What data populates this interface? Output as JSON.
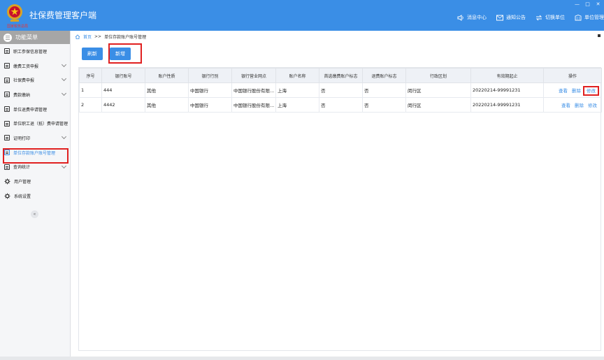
{
  "app": {
    "title": "社保费管理客户端",
    "logo_sub": "国家税务总局"
  },
  "window_controls": [
    "—",
    "□",
    "✕"
  ],
  "header_nav": [
    {
      "label": "消息中心",
      "icon": "message-icon"
    },
    {
      "label": "通知公告",
      "icon": "notice-icon"
    },
    {
      "label": "切换单位",
      "icon": "switch-icon"
    },
    {
      "label": "单位管理",
      "icon": "building-icon"
    }
  ],
  "sidebar": {
    "title": "功能菜单",
    "items": [
      {
        "label": "职工参保信息管理",
        "icon": "doc-icon",
        "chevron": false,
        "active": false
      },
      {
        "label": "缴费工资申报",
        "icon": "doc-icon",
        "chevron": true,
        "active": false
      },
      {
        "label": "社保费申报",
        "icon": "doc-icon",
        "chevron": true,
        "active": false
      },
      {
        "label": "费款缴纳",
        "icon": "doc-icon",
        "chevron": true,
        "active": false
      },
      {
        "label": "单位退费申请管理",
        "icon": "doc-icon",
        "chevron": false,
        "active": false
      },
      {
        "label": "单位职工退（抵）费申请管理",
        "icon": "doc-icon",
        "chevron": false,
        "active": false
      },
      {
        "label": "证明打印",
        "icon": "doc-icon",
        "chevron": true,
        "active": false
      },
      {
        "label": "单位存款账户账号管理",
        "icon": "doc-icon",
        "chevron": false,
        "active": true
      },
      {
        "label": "查询统计",
        "icon": "doc-icon",
        "chevron": true,
        "active": false
      },
      {
        "label": "用户管理",
        "icon": "gear-icon",
        "chevron": false,
        "active": false
      },
      {
        "label": "系统设置",
        "icon": "gear-icon",
        "chevron": false,
        "active": false
      }
    ],
    "collapse": "«"
  },
  "breadcrumb": {
    "home": "首页",
    "sep": ">>",
    "current": "单位存款账户账号管理"
  },
  "toolbar": {
    "refresh": "刷新",
    "add": "新增"
  },
  "table": {
    "headers": [
      "序号",
      "银行账号",
      "账户性质",
      "银行行别",
      "银行营业网点",
      "账户名称",
      "首选缴费账户标志",
      "退费账户标志",
      "行政区划",
      "有效期起止",
      "操作"
    ],
    "rows": [
      {
        "cells": [
          "1",
          "444",
          "其他",
          "中国银行",
          "中国银行股份有限...",
          "上海",
          "否",
          "否",
          "闵行区",
          "20220214-99991231"
        ],
        "ops": [
          "查看",
          "删除",
          "修改"
        ]
      },
      {
        "cells": [
          "2",
          "4442",
          "其他",
          "中国银行",
          "中国银行股份有限...",
          "上海",
          "否",
          "否",
          "闵行区",
          "20220214-99991231"
        ],
        "ops": [
          "查看",
          "删除",
          "修改"
        ]
      }
    ]
  },
  "colors": {
    "primary": "#3a8ee6",
    "highlight": "#e02020",
    "sidebar_head": "#a6a6a6"
  }
}
